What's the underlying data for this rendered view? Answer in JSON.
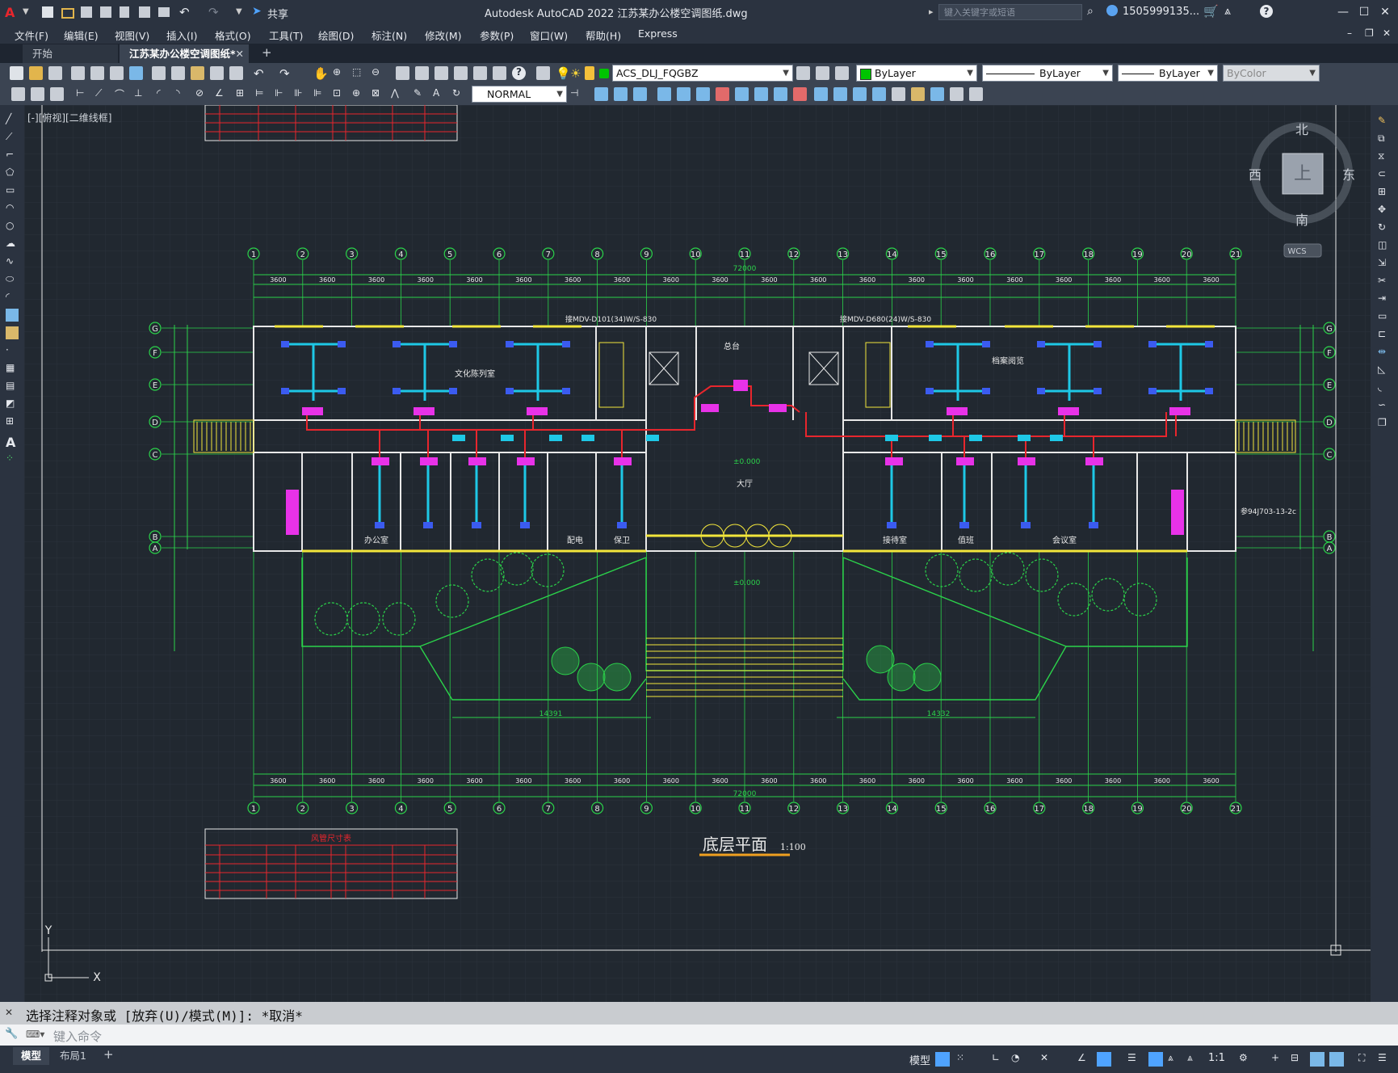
{
  "app": {
    "title": "Autodesk AutoCAD 2022    江苏某办公楼空调图纸.dwg",
    "search_placeholder": "键入关键字或短语",
    "user": "1505999135...",
    "share_label": "共享",
    "accent": "#e8262d"
  },
  "menu": [
    "文件(F)",
    "编辑(E)",
    "视图(V)",
    "插入(I)",
    "格式(O)",
    "工具(T)",
    "绘图(D)",
    "标注(N)",
    "修改(M)",
    "参数(P)",
    "窗口(W)",
    "帮助(H)",
    "Express"
  ],
  "tabs": {
    "start": "开始",
    "drawing": "江苏某办公楼空调图纸*"
  },
  "toolbar": {
    "layer_name": "ACS_DLJ_FQGBZ",
    "color": "ByLayer",
    "linetype": "ByLayer",
    "lineweight": "ByLayer",
    "plotstyle": "ByColor",
    "dimstyle": "NORMAL"
  },
  "viewport_label": "[-][俯视][二维线框]",
  "viewcube": {
    "north": "北",
    "south": "南",
    "east": "东",
    "west": "西",
    "face": "上",
    "wcs": "WCS"
  },
  "drawing": {
    "title": "底层平面",
    "scale": "1:100",
    "schedule_title": "风管尺寸表",
    "total_dim": "72000",
    "room_cultural": "文化陈列室",
    "room_archive": "档案阅览",
    "room_reception": "总台",
    "room_lobby": "大厅",
    "room_office": "办公室",
    "room_meeting": "会议室",
    "room_lounge": "接待室",
    "room_duty": "值班",
    "room_power": "配电",
    "room_security": "保卫",
    "note_left": "接MDV-D101(34)W/S-830",
    "note_right": "接MDV-D680(24)W/S-830",
    "elev_lobby": "±0.000",
    "elev_outside": "±0.000",
    "note_detail": "参94J703-13-2c",
    "dim_bottom_left": "14391",
    "dim_bottom_right": "14332",
    "axes": [
      "1",
      "2",
      "3",
      "4",
      "5",
      "6",
      "7",
      "8",
      "9",
      "10",
      "11",
      "12",
      "13",
      "14",
      "15",
      "16",
      "17",
      "18",
      "19",
      "20",
      "21"
    ],
    "rows": [
      "G",
      "F",
      "E",
      "D",
      "C",
      "B",
      "A"
    ],
    "bay": "3600"
  },
  "command": {
    "history": "选择注释对象或 [放弃(U)/模式(M)]: *取消*",
    "placeholder": "键入命令"
  },
  "layouts": {
    "model": "模型",
    "layout1": "布局1"
  },
  "status": {
    "model_space": "模型",
    "scale": "1:1"
  }
}
